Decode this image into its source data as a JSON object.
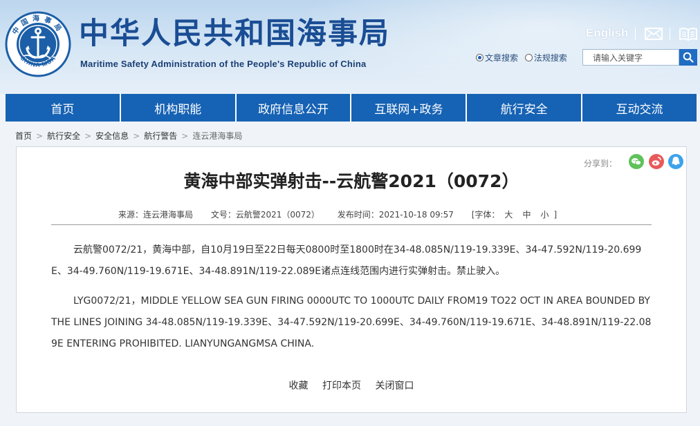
{
  "header": {
    "site_title": "中华人民共和国海事局",
    "site_subtitle": "Maritime Safety Administration of the People's Republic of China",
    "logo_top_text": "中国海事局",
    "logo_bottom_text": "CHINA MSA",
    "english_link": "English",
    "icons": [
      "mail-icon",
      "book-icon",
      "search-icon"
    ],
    "search": {
      "options": [
        {
          "label": "文章搜索",
          "selected": true
        },
        {
          "label": "法规搜索",
          "selected": false
        }
      ],
      "placeholder": "请输入关键字"
    }
  },
  "nav": {
    "items": [
      "首页",
      "机构职能",
      "政府信息公开",
      "互联网+政务",
      "航行安全",
      "互动交流"
    ]
  },
  "breadcrumb": {
    "items": [
      "首页",
      "航行安全",
      "安全信息",
      "航行警告"
    ],
    "current": "连云港海事局",
    "separator": ">"
  },
  "article": {
    "share_label": "分享到：",
    "share_icons": [
      "wechat-icon",
      "weibo-icon",
      "qq-icon"
    ],
    "title": "黄海中部实弹射击--云航警2021（0072）",
    "source": "来源：连云港海事局",
    "doc_no": "文号：云航警2021（0072）",
    "publish_time": "发布时间：2021-10-18 09:57",
    "font_label_open": "[字体：",
    "font_sizes": [
      "大",
      "中",
      "小"
    ],
    "font_label_close": "]",
    "paragraph_cn": "云航警0072/21，黄海中部，自10月19日至22日每天0800时至1800时在34-48.085N/119-19.339E、34-47.592N/119-20.699E、34-49.760N/119-19.671E、34-48.891N/119-22.089E诸点连线范围内进行实弹射击。禁止驶入。",
    "paragraph_en": "LYG0072/21，MIDDLE YELLOW SEA GUN FIRING 0000UTC TO 1000UTC DAILY FROM19 TO22 OCT IN AREA BOUNDED BY THE LINES JOINING 34-48.085N/119-19.339E、34-47.592N/119-20.699E、34-49.760N/119-19.671E、34-48.891N/119-22.089E ENTERING PROHIBITED. LIANYUNGANGMSA CHINA.",
    "actions": [
      "收藏",
      "打印本页",
      "关闭窗口"
    ]
  },
  "colors": {
    "nav_bg": "#1662b4",
    "title_blue": "#1a4d94",
    "wechat": "#5fc25b",
    "weibo": "#e85a5a",
    "qq": "#3da3ea"
  }
}
